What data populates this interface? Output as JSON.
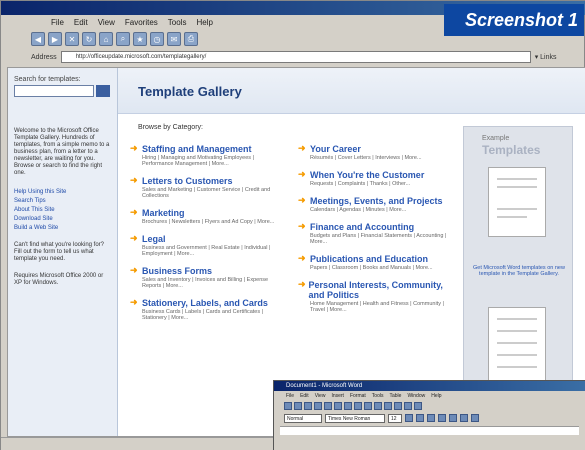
{
  "badge": {
    "text": "Screenshot 1"
  },
  "menu": {
    "items": [
      "File",
      "Edit",
      "View",
      "Favorites",
      "Tools",
      "Help"
    ]
  },
  "address": {
    "label": "Address",
    "url": "http://officeupdate.microsoft.com/templategallery/"
  },
  "left": {
    "search_title": "Search for templates:",
    "welcome": "Welcome to the Microsoft Office Template Gallery. Hundreds of templates, from a simple memo to a business plan, from a letter to a newsletter, are waiting for you. Browse or search to find the right one.",
    "links": [
      "Help Using this Site",
      "Search Tips",
      "About This Site",
      "Download Site",
      "Build a Web Site"
    ],
    "find_text": "Can't find what you're looking for? Fill out the form to tell us what template you need.",
    "req_text": "Requires Microsoft Office 2000 or XP for Windows."
  },
  "main": {
    "title": "Template Gallery",
    "browse": "Browse by Category:",
    "col1": [
      {
        "title": "Staffing and Management",
        "sub": "Hiring | Managing and Motivating Employees | Performance Management | More..."
      },
      {
        "title": "Letters to Customers",
        "sub": "Sales and Marketing | Customer Service | Credit and Collections"
      },
      {
        "title": "Marketing",
        "sub": "Brochures | Newsletters | Flyers and Ad Copy | More..."
      },
      {
        "title": "Legal",
        "sub": "Business and Government | Real Estate | Individual | Employment | More..."
      },
      {
        "title": "Business Forms",
        "sub": "Sales and Inventory | Invoices and Billing | Expense Reports | More..."
      },
      {
        "title": "Stationery, Labels, and Cards",
        "sub": "Business Cards | Labels | Cards and Certificates | Stationery | More..."
      }
    ],
    "col2": [
      {
        "title": "Your Career",
        "sub": "Résumés | Cover Letters | Interviews | More..."
      },
      {
        "title": "When You're the Customer",
        "sub": "Requests | Complaints | Thanks | Other..."
      },
      {
        "title": "Meetings, Events, and Projects",
        "sub": "Calendars | Agendas | Minutes | More..."
      },
      {
        "title": "Finance and Accounting",
        "sub": "Budgets and Plans | Financial Statements | Accounting | More..."
      },
      {
        "title": "Publications and Education",
        "sub": "Papers | Classroom | Books and Manuals | More..."
      },
      {
        "title": "Personal Interests, Community, and Politics",
        "sub": "Home Management | Health and Fitness | Community | Travel | More..."
      }
    ]
  },
  "right": {
    "ex_small": "Example",
    "ex_big": "Templates",
    "caption": "Get Microsoft Word templates on new template in the Template Gallery."
  },
  "word": {
    "title": "Document1 - Microsoft Word",
    "menu": [
      "File",
      "Edit",
      "View",
      "Insert",
      "Format",
      "Tools",
      "Table",
      "Window",
      "Help"
    ],
    "style": "Normal",
    "font": "Times New Roman",
    "size": "12"
  }
}
